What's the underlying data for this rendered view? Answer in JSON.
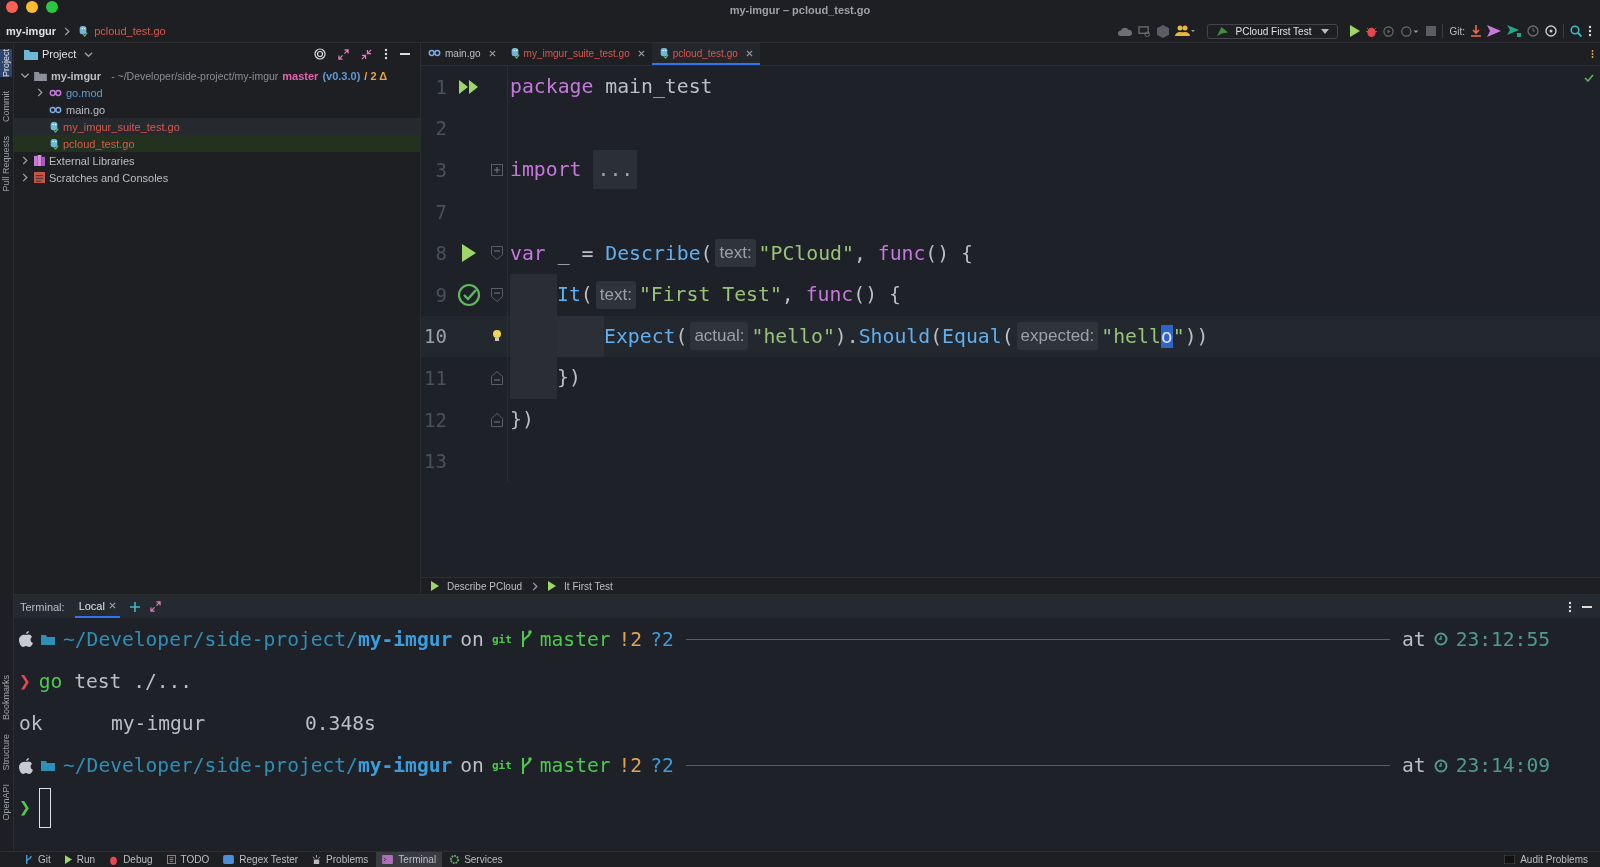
{
  "window": {
    "title": "my-imgur – pcloud_test.go"
  },
  "navbar": {
    "breadcrumb": [
      {
        "label": "my-imgur",
        "kind": "project"
      },
      {
        "label": "pcloud_test.go",
        "kind": "test"
      }
    ],
    "run_config": "PCloud First Test",
    "vcs_label": "Git:"
  },
  "tool_strip": {
    "top": [
      {
        "label": "Project",
        "selected": true
      },
      {
        "label": "Commit",
        "selected": false
      },
      {
        "label": "Pull Requests",
        "selected": false
      }
    ],
    "bottom": [
      {
        "label": "Bookmarks",
        "selected": false
      },
      {
        "label": "Structure",
        "selected": false
      },
      {
        "label": "OpenAPI",
        "selected": false
      }
    ]
  },
  "project_panel": {
    "title": "Project",
    "tree": [
      {
        "name": "my-imgur",
        "kind": "folder",
        "expanded": true,
        "selected": false,
        "path": "- ~/Developer/side-project/my-imgur",
        "branch": "master",
        "tag": "(v0.3.0)",
        "changes": "/ 2 Δ",
        "children": [
          {
            "name": "go.mod",
            "kind": "mod",
            "expanded": false,
            "selected": false,
            "color": "#5b9bd5"
          },
          {
            "name": "main.go",
            "kind": "go",
            "selected": false,
            "color": "#bcbec4"
          },
          {
            "name": "my_imgur_suite_test.go",
            "kind": "test",
            "selected": false,
            "color": "#d9584e"
          },
          {
            "name": "pcloud_test.go",
            "kind": "test",
            "selected": true,
            "color": "#d9584e"
          }
        ]
      },
      {
        "name": "External Libraries",
        "kind": "library",
        "expanded": false,
        "selected": false
      },
      {
        "name": "Scratches and Consoles",
        "kind": "scratch",
        "expanded": false,
        "selected": false
      }
    ]
  },
  "editor": {
    "tabs": [
      {
        "label": "main.go",
        "kind": "go",
        "selected": false
      },
      {
        "label": "my_imgur_suite_test.go",
        "kind": "test",
        "selected": false
      },
      {
        "label": "pcloud_test.go",
        "kind": "test",
        "selected": true
      }
    ],
    "lines": [
      {
        "number": "1",
        "gutter": {
          "kind": "run-all"
        },
        "current": false,
        "tokens": [
          {
            "kind": "keyword",
            "text": "package"
          },
          {
            "kind": "plain",
            "text": " main_test"
          }
        ]
      },
      {
        "number": "2",
        "current": false
      },
      {
        "number": "3",
        "fold": {
          "kind": "plus"
        },
        "current": false,
        "tokens": [
          {
            "kind": "keyword",
            "text": "import"
          },
          {
            "kind": "folded",
            "text": "..."
          }
        ]
      },
      {
        "number": "7",
        "current": false
      },
      {
        "number": "8",
        "gutter": {
          "kind": "run"
        },
        "fold": {
          "kind": "open"
        },
        "current": false,
        "tokens": [
          {
            "kind": "keyword",
            "text": "var"
          },
          {
            "kind": "plain",
            "text": " _ = "
          },
          {
            "kind": "func",
            "text": "Describe"
          },
          {
            "kind": "plain",
            "text": "("
          },
          {
            "kind": "hint",
            "text": "text:"
          },
          {
            "kind": "string",
            "text": "\"PCloud\""
          },
          {
            "kind": "plain",
            "text": ", "
          },
          {
            "kind": "keyword",
            "text": "func"
          },
          {
            "kind": "plain",
            "text": "() {"
          }
        ]
      },
      {
        "number": "9",
        "gutter": {
          "kind": "passed"
        },
        "fold": {
          "kind": "open"
        },
        "current": false,
        "indent_guides": [
          {
            "kind": "guide"
          }
        ],
        "tokens": [
          {
            "kind": "func",
            "text": "It"
          },
          {
            "kind": "plain",
            "text": "("
          },
          {
            "kind": "hint",
            "text": "text:"
          },
          {
            "kind": "string",
            "text": "\"First Test\""
          },
          {
            "kind": "plain",
            "text": ", "
          },
          {
            "kind": "keyword",
            "text": "func"
          },
          {
            "kind": "plain",
            "text": "() {"
          }
        ]
      },
      {
        "number": "10",
        "fold": {
          "kind": "bulb"
        },
        "current": true,
        "indent_guides": [
          {
            "kind": "guide"
          },
          {
            "kind": "guide"
          }
        ],
        "tokens": [
          {
            "kind": "func",
            "text": "Expect"
          },
          {
            "kind": "plain",
            "text": "("
          },
          {
            "kind": "hint",
            "text": "actual:"
          },
          {
            "kind": "string",
            "text": "\"hello\""
          },
          {
            "kind": "plain",
            "text": ")."
          },
          {
            "kind": "func",
            "text": "Should"
          },
          {
            "kind": "plain",
            "text": "("
          },
          {
            "kind": "func",
            "text": "Equal"
          },
          {
            "kind": "plain",
            "text": "("
          },
          {
            "kind": "hint",
            "text": "expected:"
          },
          {
            "kind": "string",
            "text": "\"hell"
          },
          {
            "kind": "selection",
            "text": "o"
          },
          {
            "kind": "string",
            "text": "\""
          },
          {
            "kind": "plain",
            "text": "))"
          }
        ]
      },
      {
        "number": "11",
        "fold": {
          "kind": "close"
        },
        "current": false,
        "indent_guides": [
          {
            "kind": "guide"
          }
        ],
        "tokens": [
          {
            "kind": "plain",
            "text": "})"
          }
        ]
      },
      {
        "number": "12",
        "fold": {
          "kind": "close"
        },
        "current": false,
        "tokens": [
          {
            "kind": "plain",
            "text": "})"
          }
        ]
      },
      {
        "number": "13",
        "current": false
      }
    ],
    "breadcrumb": [
      "Describe PCloud",
      "It First Test"
    ]
  },
  "terminal": {
    "title": "Terminal:",
    "tabs": [
      {
        "label": "Local",
        "selected": true
      }
    ],
    "lines": [
      {
        "kind": "prompt",
        "path": "~/Developer/side-project/",
        "dir": "my-imgur",
        "on": "on",
        "git": "git",
        "branch": "master",
        "modified": "!2",
        "untracked": "?2",
        "at": "at",
        "time": "23:12:55"
      },
      {
        "kind": "command",
        "symbol": "❯",
        "success": false,
        "command": "go",
        "args": "test ./..."
      },
      {
        "kind": "output",
        "columns": [
          "ok",
          "my-imgur",
          "0.348s"
        ]
      },
      {
        "kind": "prompt",
        "path": "~/Developer/side-project/",
        "dir": "my-imgur",
        "on": "on",
        "git": "git",
        "branch": "master",
        "modified": "!2",
        "untracked": "?2",
        "at": "at",
        "time": "23:14:09"
      },
      {
        "kind": "input",
        "symbol": "❯",
        "success": true
      }
    ]
  },
  "status_bar": {
    "tools": [
      {
        "label": "Git",
        "kind": "git",
        "selected": false
      },
      {
        "label": "Run",
        "kind": "run",
        "selected": false
      },
      {
        "label": "Debug",
        "kind": "debug",
        "selected": false
      },
      {
        "label": "TODO",
        "kind": "todo",
        "selected": false
      },
      {
        "label": "Regex Tester",
        "kind": "regex",
        "selected": false
      },
      {
        "label": "Problems",
        "kind": "problems",
        "selected": false
      },
      {
        "label": "Terminal",
        "kind": "terminal",
        "selected": true
      },
      {
        "label": "Services",
        "kind": "services",
        "selected": false
      }
    ],
    "right": "Audit Problems"
  }
}
